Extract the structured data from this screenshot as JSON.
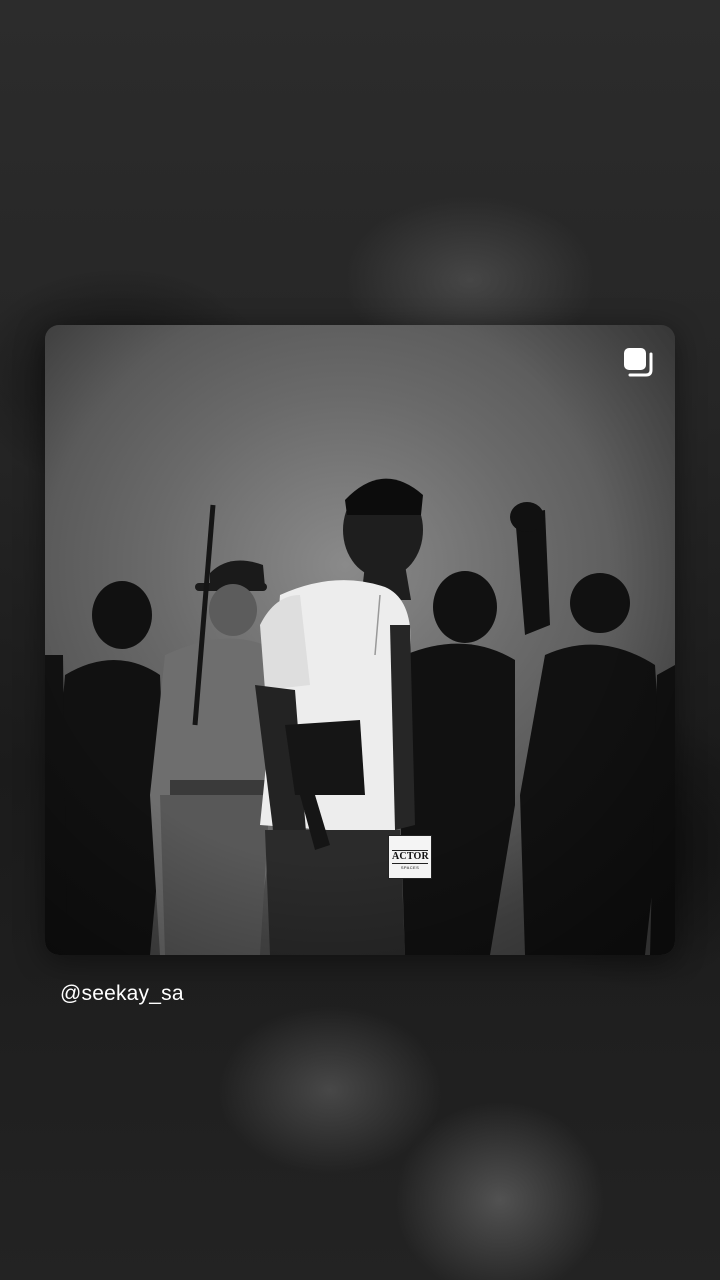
{
  "post": {
    "username": "@seekay_sa",
    "brand_tag": {
      "title": "ACTOR",
      "subtitle": "SPACES"
    },
    "multi_post_icon": "multiple-posts-icon"
  }
}
